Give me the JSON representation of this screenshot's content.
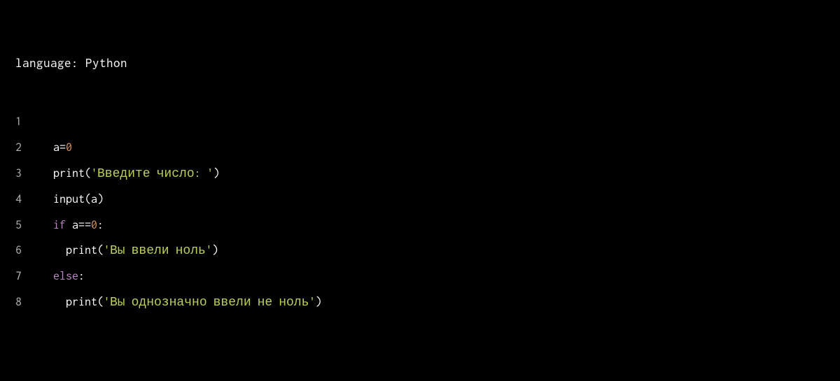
{
  "header": {
    "language_label": "language:",
    "language_value": "Python"
  },
  "code": {
    "lines": [
      {
        "num": "1",
        "tokens": []
      },
      {
        "num": "2",
        "tokens": [
          {
            "cls": "tok-var",
            "text": "a"
          },
          {
            "cls": "tok-op",
            "text": "="
          },
          {
            "cls": "tok-num",
            "text": "0"
          }
        ]
      },
      {
        "num": "3",
        "tokens": [
          {
            "cls": "tok-fn",
            "text": "print"
          },
          {
            "cls": "tok-paren",
            "text": "("
          },
          {
            "cls": "tok-str",
            "text": "'Введите число: '"
          },
          {
            "cls": "tok-paren",
            "text": ")"
          }
        ]
      },
      {
        "num": "4",
        "tokens": [
          {
            "cls": "tok-fn",
            "text": "input"
          },
          {
            "cls": "tok-paren",
            "text": "("
          },
          {
            "cls": "tok-var",
            "text": "a"
          },
          {
            "cls": "tok-paren",
            "text": ")"
          }
        ]
      },
      {
        "num": "5",
        "tokens": [
          {
            "cls": "tok-kw",
            "text": "if"
          },
          {
            "cls": "tok-var",
            "text": " a"
          },
          {
            "cls": "tok-op",
            "text": "=="
          },
          {
            "cls": "tok-num",
            "text": "0"
          },
          {
            "cls": "tok-colon",
            "text": ":"
          }
        ]
      },
      {
        "num": "6",
        "tokens": [
          {
            "cls": "tok-var",
            "text": "  "
          },
          {
            "cls": "tok-fn",
            "text": "print"
          },
          {
            "cls": "tok-paren",
            "text": "("
          },
          {
            "cls": "tok-str",
            "text": "'Вы ввели ноль'"
          },
          {
            "cls": "tok-paren",
            "text": ")"
          }
        ]
      },
      {
        "num": "7",
        "tokens": [
          {
            "cls": "tok-kw",
            "text": "else"
          },
          {
            "cls": "tok-colon",
            "text": ":"
          }
        ]
      },
      {
        "num": "8",
        "tokens": [
          {
            "cls": "tok-var",
            "text": "  "
          },
          {
            "cls": "tok-fn",
            "text": "print"
          },
          {
            "cls": "tok-paren",
            "text": "("
          },
          {
            "cls": "tok-str",
            "text": "'Вы однозначно ввели не ноль'"
          },
          {
            "cls": "tok-paren",
            "text": ")"
          }
        ]
      }
    ]
  }
}
